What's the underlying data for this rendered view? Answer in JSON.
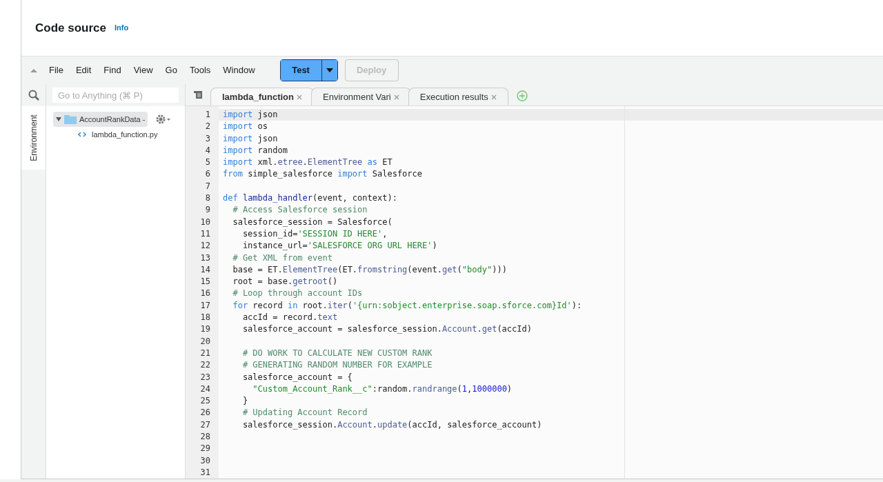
{
  "header": {
    "title": "Code source",
    "info_link": "Info"
  },
  "menu": [
    "File",
    "Edit",
    "Find",
    "View",
    "Go",
    "Tools",
    "Window"
  ],
  "toolbar": {
    "test": "Test",
    "deploy": "Deploy",
    "deploy_disabled": true
  },
  "search": {
    "placeholder": "Go to Anything (⌘ P)"
  },
  "side_tab": "Environment",
  "tree": [
    {
      "label": "AccountRankData -",
      "kind": "folder",
      "expanded": true,
      "children": [
        {
          "label": "lambda_function.py",
          "kind": "file"
        }
      ]
    }
  ],
  "tabs": [
    {
      "label": "lambda_function",
      "selected": true
    },
    {
      "label": "Environment Vari",
      "selected": false
    },
    {
      "label": "Execution results",
      "selected": false
    }
  ],
  "lines": [
    {
      "number": "1",
      "tokens": [
        {
          "kind": "keyword",
          "text": "import"
        },
        {
          "kind": "plain",
          "text": " json"
        }
      ]
    },
    {
      "number": "2",
      "tokens": [
        {
          "kind": "keyword",
          "text": "import"
        },
        {
          "kind": "plain",
          "text": " os"
        }
      ]
    },
    {
      "number": "3",
      "tokens": [
        {
          "kind": "keyword",
          "text": "import"
        },
        {
          "kind": "plain",
          "text": " json"
        }
      ]
    },
    {
      "number": "4",
      "tokens": [
        {
          "kind": "keyword",
          "text": "import"
        },
        {
          "kind": "plain",
          "text": " random"
        }
      ]
    },
    {
      "number": "5",
      "tokens": [
        {
          "kind": "keyword",
          "text": "import"
        },
        {
          "kind": "plain",
          "text": " xml."
        },
        {
          "kind": "attr",
          "text": "etree"
        },
        {
          "kind": "plain",
          "text": "."
        },
        {
          "kind": "attr",
          "text": "ElementTree"
        },
        {
          "kind": "keyword",
          "text": " as"
        },
        {
          "kind": "plain",
          "text": " ET"
        }
      ]
    },
    {
      "number": "6",
      "tokens": [
        {
          "kind": "keyword",
          "text": "from"
        },
        {
          "kind": "plain",
          "text": " simple_salesforce "
        },
        {
          "kind": "keyword",
          "text": "import"
        },
        {
          "kind": "plain",
          "text": " Salesforce"
        }
      ]
    },
    {
      "number": "7"
    },
    {
      "number": "8",
      "tokens": [
        {
          "kind": "keyword",
          "text": "def"
        },
        {
          "kind": "function",
          "text": " lambda_handler"
        },
        {
          "kind": "plain",
          "text": "(event, context):"
        }
      ]
    },
    {
      "number": "9",
      "tokens": [
        {
          "kind": "comment",
          "text": "  # Access Salesforce session"
        }
      ]
    },
    {
      "number": "10",
      "tokens": [
        {
          "kind": "plain",
          "text": "  salesforce_session = Salesforce("
        }
      ]
    },
    {
      "number": "11",
      "tokens": [
        {
          "kind": "plain",
          "text": "    session_id="
        },
        {
          "kind": "string",
          "text": "'SESSION ID HERE'"
        },
        {
          "kind": "plain",
          "text": ","
        }
      ]
    },
    {
      "number": "12",
      "tokens": [
        {
          "kind": "plain",
          "text": "    instance_url="
        },
        {
          "kind": "string",
          "text": "'SALESFORCE ORG URL HERE'"
        },
        {
          "kind": "plain",
          "text": ")"
        }
      ]
    },
    {
      "number": "13",
      "tokens": [
        {
          "kind": "comment",
          "text": "  # Get XML from event"
        }
      ]
    },
    {
      "number": "14",
      "tokens": [
        {
          "kind": "plain",
          "text": "  base = ET."
        },
        {
          "kind": "attr",
          "text": "ElementTree"
        },
        {
          "kind": "plain",
          "text": "(ET."
        },
        {
          "kind": "attr",
          "text": "fromstring"
        },
        {
          "kind": "plain",
          "text": "(event."
        },
        {
          "kind": "attr",
          "text": "get"
        },
        {
          "kind": "plain",
          "text": "("
        },
        {
          "kind": "string",
          "text": "\"body\""
        },
        {
          "kind": "plain",
          "text": ")))"
        }
      ]
    },
    {
      "number": "15",
      "tokens": [
        {
          "kind": "plain",
          "text": "  root = base."
        },
        {
          "kind": "attr",
          "text": "getroot"
        },
        {
          "kind": "plain",
          "text": "()"
        }
      ]
    },
    {
      "number": "16",
      "tokens": [
        {
          "kind": "comment",
          "text": "  # Loop through account IDs"
        }
      ]
    },
    {
      "number": "17",
      "tokens": [
        {
          "kind": "keyword",
          "text": "  for"
        },
        {
          "kind": "plain",
          "text": " record "
        },
        {
          "kind": "keyword",
          "text": "in"
        },
        {
          "kind": "plain",
          "text": " root."
        },
        {
          "kind": "attr",
          "text": "iter"
        },
        {
          "kind": "plain",
          "text": "("
        },
        {
          "kind": "string",
          "text": "'{urn:sobject.enterprise.soap.sforce.com}Id'"
        },
        {
          "kind": "plain",
          "text": "):"
        }
      ]
    },
    {
      "number": "18",
      "tokens": [
        {
          "kind": "plain",
          "text": "    accId = record."
        },
        {
          "kind": "attr",
          "text": "text"
        }
      ]
    },
    {
      "number": "19",
      "tokens": [
        {
          "kind": "plain",
          "text": "    salesforce_account = salesforce_session."
        },
        {
          "kind": "attr",
          "text": "Account"
        },
        {
          "kind": "plain",
          "text": "."
        },
        {
          "kind": "attr",
          "text": "get"
        },
        {
          "kind": "plain",
          "text": "(accId)"
        }
      ]
    },
    {
      "number": "20"
    },
    {
      "number": "21",
      "tokens": [
        {
          "kind": "comment",
          "text": "    # DO WORK TO CALCULATE NEW CUSTOM RANK"
        }
      ]
    },
    {
      "number": "22",
      "tokens": [
        {
          "kind": "comment",
          "text": "    # GENERATING RANDOM NUMBER FOR EXAMPLE"
        }
      ]
    },
    {
      "number": "23",
      "tokens": [
        {
          "kind": "plain",
          "text": "    salesforce_account = {"
        }
      ]
    },
    {
      "number": "24",
      "tokens": [
        {
          "kind": "string",
          "text": "      \"Custom_Account_Rank__c\""
        },
        {
          "kind": "plain",
          "text": ":random."
        },
        {
          "kind": "attr",
          "text": "randrange"
        },
        {
          "kind": "plain",
          "text": "("
        },
        {
          "kind": "number",
          "text": "1"
        },
        {
          "kind": "plain",
          "text": ","
        },
        {
          "kind": "number",
          "text": "1000000"
        },
        {
          "kind": "plain",
          "text": ")"
        }
      ]
    },
    {
      "number": "25",
      "tokens": [
        {
          "kind": "plain",
          "text": "    }"
        }
      ]
    },
    {
      "number": "26",
      "tokens": [
        {
          "kind": "comment",
          "text": "    # Updating Account Record"
        }
      ]
    },
    {
      "number": "27",
      "tokens": [
        {
          "kind": "plain",
          "text": "    salesforce_session."
        },
        {
          "kind": "attr",
          "text": "Account"
        },
        {
          "kind": "plain",
          "text": "."
        },
        {
          "kind": "attr",
          "text": "update"
        },
        {
          "kind": "plain",
          "text": "(accId, salesforce_account)"
        }
      ]
    },
    {
      "number": "28"
    },
    {
      "number": "29"
    },
    {
      "number": "30"
    },
    {
      "number": "31"
    }
  ]
}
